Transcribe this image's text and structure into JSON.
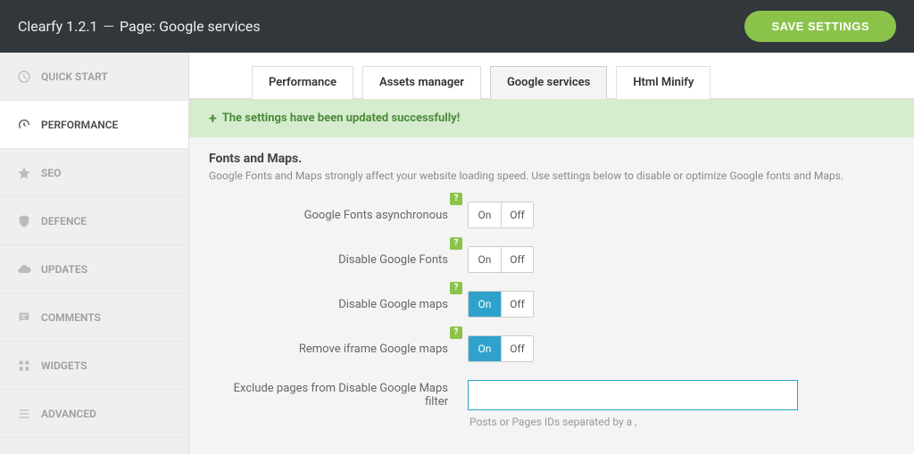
{
  "header": {
    "app_name": "Clearfy 1.2.1",
    "separator": "—",
    "page_label": "Page: Google services",
    "save_btn": "SAVE SETTINGS"
  },
  "sidebar": {
    "items": [
      {
        "label": "QUICK START"
      },
      {
        "label": "PERFORMANCE"
      },
      {
        "label": "SEO"
      },
      {
        "label": "DEFENCE"
      },
      {
        "label": "UPDATES"
      },
      {
        "label": "COMMENTS"
      },
      {
        "label": "WIDGETS"
      },
      {
        "label": "ADVANCED"
      }
    ]
  },
  "tabs": [
    {
      "label": "Performance"
    },
    {
      "label": "Assets manager"
    },
    {
      "label": "Google services"
    },
    {
      "label": "Html Minify"
    }
  ],
  "notice": {
    "text": "The settings have been updated successfully!"
  },
  "section": {
    "title": "Fonts and Maps",
    "desc": "Google Fonts and Maps strongly affect your website loading speed. Use settings below to disable or optimize Google fonts and Maps."
  },
  "toggle_labels": {
    "on": "On",
    "off": "Off"
  },
  "settings": {
    "fonts_async": {
      "label": "Google Fonts asynchronous",
      "value": "off"
    },
    "disable_fonts": {
      "label": "Disable Google Fonts",
      "value": "off"
    },
    "disable_maps": {
      "label": "Disable Google maps",
      "value": "on"
    },
    "remove_iframe": {
      "label": "Remove iframe Google maps",
      "value": "on"
    },
    "exclude_pages": {
      "label": "Exclude pages from Disable Google Maps filter",
      "value": "",
      "hint": "Posts or Pages IDs separated by a ,"
    }
  }
}
